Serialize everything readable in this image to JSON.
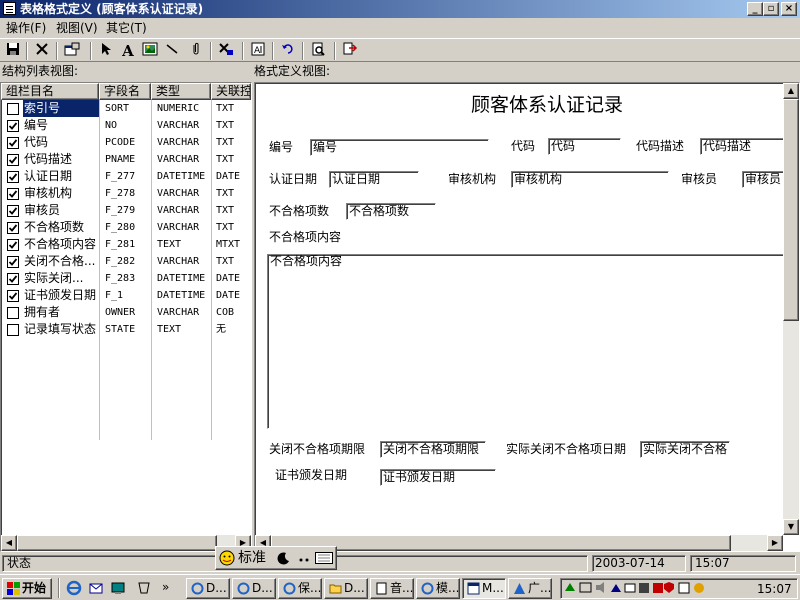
{
  "window": {
    "title": "表格格式定义 (顾客体系认证记录)",
    "controls": [
      "_",
      "▫",
      "×"
    ]
  },
  "menu": [
    {
      "label": "操作(F)"
    },
    {
      "label": "视图(V)"
    },
    {
      "label": "其它(T)"
    }
  ],
  "toolbar": {
    "icons": [
      "save-icon",
      "delete-icon",
      "properties-icon",
      "pointer-icon",
      "text-icon",
      "image-icon",
      "line-icon",
      "attach-icon",
      "tools-icon",
      "font-icon",
      "undo-icon",
      "preview-icon",
      "export-icon"
    ]
  },
  "panes": {
    "left_label": "结构列表视图:",
    "right_label": "格式定义视图:"
  },
  "structure_table": {
    "columns": [
      "组栏目名",
      "字段名",
      "类型",
      "关联控"
    ],
    "rows": [
      {
        "checked": false,
        "selected": true,
        "name": "索引号",
        "field": "SORT",
        "type": "NUMERIC",
        "ctrl": "TXT"
      },
      {
        "checked": true,
        "selected": false,
        "name": "编号",
        "field": "NO",
        "type": "VARCHAR",
        "ctrl": "TXT"
      },
      {
        "checked": true,
        "selected": false,
        "name": "代码",
        "field": "PCODE",
        "type": "VARCHAR",
        "ctrl": "TXT"
      },
      {
        "checked": true,
        "selected": false,
        "name": "代码描述",
        "field": "PNAME",
        "type": "VARCHAR",
        "ctrl": "TXT"
      },
      {
        "checked": true,
        "selected": false,
        "name": "认证日期",
        "field": "F_277",
        "type": "DATETIME",
        "ctrl": "DATE"
      },
      {
        "checked": true,
        "selected": false,
        "name": "审核机构",
        "field": "F_278",
        "type": "VARCHAR",
        "ctrl": "TXT"
      },
      {
        "checked": true,
        "selected": false,
        "name": "审核员",
        "field": "F_279",
        "type": "VARCHAR",
        "ctrl": "TXT"
      },
      {
        "checked": true,
        "selected": false,
        "name": "不合格项数",
        "field": "F_280",
        "type": "VARCHAR",
        "ctrl": "TXT"
      },
      {
        "checked": true,
        "selected": false,
        "name": "不合格项内容",
        "field": "F_281",
        "type": "TEXT",
        "ctrl": "MTXT"
      },
      {
        "checked": true,
        "selected": false,
        "name": "关闭不合格...",
        "field": "F_282",
        "type": "VARCHAR",
        "ctrl": "TXT"
      },
      {
        "checked": true,
        "selected": false,
        "name": "实际关闭...",
        "field": "F_283",
        "type": "DATETIME",
        "ctrl": "DATE"
      },
      {
        "checked": true,
        "selected": false,
        "name": "证书颁发日期",
        "field": "F_1",
        "type": "DATETIME",
        "ctrl": "DATE"
      },
      {
        "checked": false,
        "selected": false,
        "name": "拥有者",
        "field": "OWNER",
        "type": "VARCHAR",
        "ctrl": "COB"
      },
      {
        "checked": false,
        "selected": false,
        "name": "记录填写状态",
        "field": "STATE",
        "type": "TEXT",
        "ctrl": "无"
      }
    ]
  },
  "form": {
    "title": "顾客体系认证记录",
    "labels": {
      "no": "编号",
      "code": "代码",
      "code_desc": "代码描述",
      "cert_date": "认证日期",
      "audit_org": "审核机构",
      "auditor": "审核员",
      "nc_count": "不合格项数",
      "nc_content": "不合格项内容",
      "close_deadline": "关闭不合格项期限",
      "actual_close": "实际关闭不合格项日期",
      "cert_issue": "证书颁发日期"
    },
    "fields": {
      "no": "编号",
      "code": "代码",
      "code_desc": "代码描述",
      "cert_date": "认证日期",
      "audit_org": "审核机构",
      "auditor": "审核员",
      "nc_count": "不合格项数",
      "nc_content": "不合格项内容",
      "close_deadline": "关闭不合格项期限",
      "actual_close": "实际关闭不合格",
      "cert_issue": "证书颁发日期"
    }
  },
  "status": {
    "label": "状态",
    "date": "2003-07-14",
    "time": "15:07"
  },
  "ime": {
    "mode": "标准"
  },
  "taskbar": {
    "start": "开始",
    "tasks": [
      "D...",
      "D...",
      "保...",
      "D...",
      "音...",
      "模...",
      "M...",
      "广..."
    ],
    "clock": "15:07"
  },
  "colors": {
    "title_start": "#0a246a",
    "title_end": "#a6caf0",
    "selection": "#0a246a",
    "face": "#d4d0c8"
  }
}
